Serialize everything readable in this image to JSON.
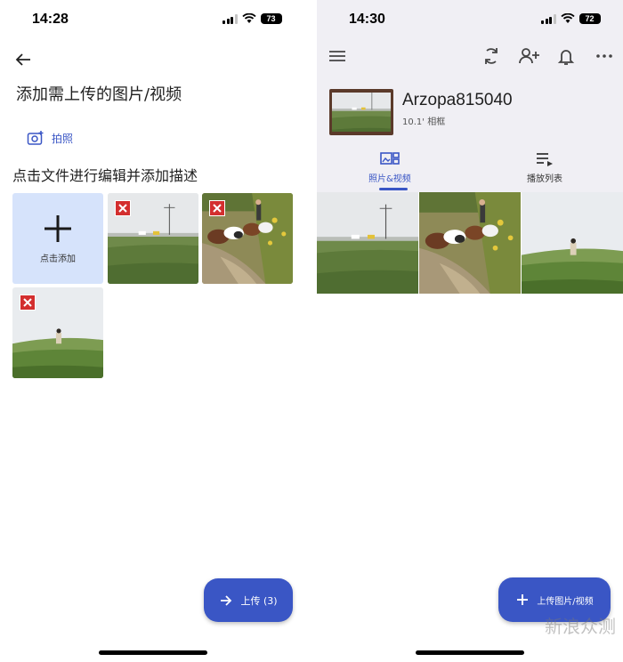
{
  "left": {
    "status": {
      "time": "14:28",
      "battery": "73"
    },
    "title": "添加需上传的图片/视频",
    "photo_label": "拍照",
    "subtitle": "点击文件进行编辑并添加描述",
    "add_label": "点击添加",
    "upload_label": "上传 (3)"
  },
  "right": {
    "status": {
      "time": "14:30",
      "battery": "72"
    },
    "device_name": "Arzopa815040",
    "device_sub": "10.1' 相框",
    "tabs": [
      {
        "label": "照片&视频",
        "active": true
      },
      {
        "label": "播放列表",
        "active": false
      }
    ],
    "upload_label": "上传图片/视频"
  },
  "watermark": {
    "main": "新浪众测",
    "brand": "新浪"
  },
  "colors": {
    "accent": "#3a56c5",
    "add_tile_bg": "#d6e3fb",
    "header_bg": "#f0eff4",
    "delete_red": "#d32f2f"
  }
}
